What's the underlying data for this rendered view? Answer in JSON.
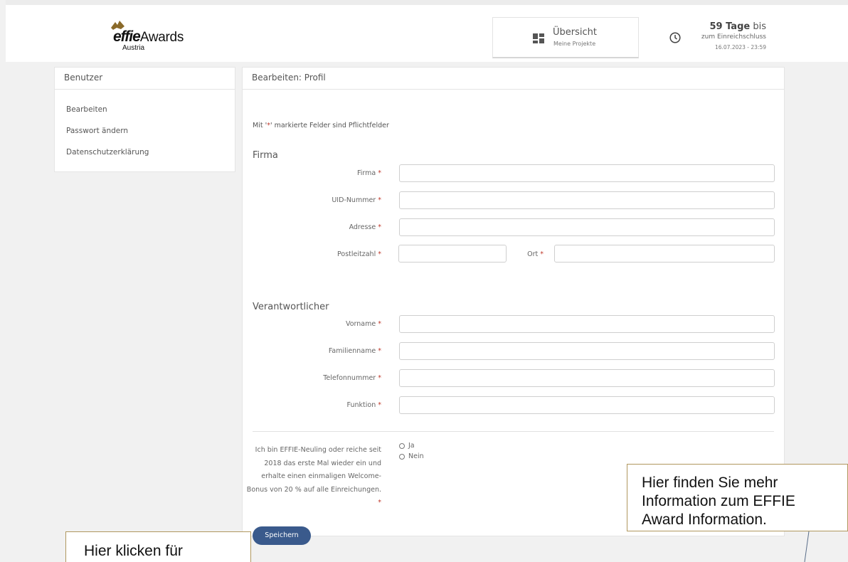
{
  "header": {
    "logo": {
      "brand_bold": "effie",
      "brand_rest": "Awards",
      "sub": "Austria"
    },
    "overview_tile": {
      "title": "Übersicht",
      "subtitle": "Meine Projekte",
      "icon": "dashboard-icon"
    },
    "deadline_tile": {
      "days_bold": "59 Tage",
      "days_rest": "bis",
      "line2": "zum Einreichschluss",
      "date": "16.07.2023 - 23:59",
      "icon": "clock-icon"
    }
  },
  "sidebar": {
    "title": "Benutzer",
    "items": [
      {
        "label": "Bearbeiten"
      },
      {
        "label": "Passwort ändern"
      },
      {
        "label": "Datenschutzerklärung"
      }
    ]
  },
  "main": {
    "title": "Bearbeiten: Profil",
    "required_note_pre": "Mit '",
    "required_note_star": "*",
    "required_note_post": "' markierte Felder sind Pflichtfelder",
    "sections": {
      "firma": {
        "title": "Firma",
        "fields": [
          {
            "label": "Firma",
            "value": ""
          },
          {
            "label": "UID-Nummer",
            "value": ""
          },
          {
            "label": "Adresse",
            "value": ""
          },
          {
            "label": "Postleitzahl",
            "value": ""
          },
          {
            "label": "Ort",
            "value": ""
          }
        ]
      },
      "verantwortlicher": {
        "title": "Verantwortlicher",
        "fields": [
          {
            "label": "Vorname",
            "value": ""
          },
          {
            "label": "Familienname",
            "value": ""
          },
          {
            "label": "Telefonnummer",
            "value": ""
          },
          {
            "label": "Funktion",
            "value": ""
          }
        ]
      }
    },
    "question": {
      "text": "Ich bin EFFIE-Neuling oder reiche seit 2018 das erste Mal wieder ein und erhalte einen einmaligen Welcome-Bonus von 20 % auf alle Einreichungen.",
      "options": [
        {
          "label": "Ja"
        },
        {
          "label": "Nein"
        }
      ]
    },
    "required_star": "*",
    "save_label": "Speichern"
  },
  "callouts": {
    "right": {
      "line1": "Hier finden Sie mehr",
      "line2": "Information zum EFFIE",
      "line3": "Award Information."
    },
    "left": {
      "line1": "Hier klicken für"
    }
  },
  "colors": {
    "accent": "#3a5a8c",
    "required": "#c0392b",
    "callout_border": "#b0975e",
    "logo_gold": "#8a6a2a"
  }
}
